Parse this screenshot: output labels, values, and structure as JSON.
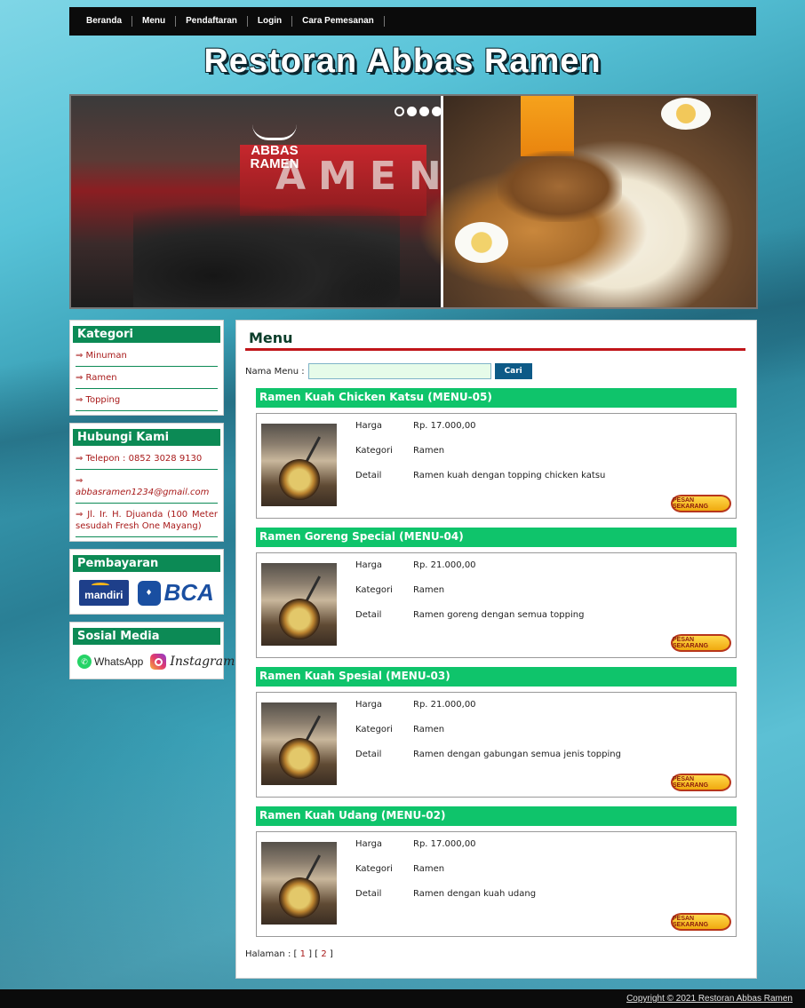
{
  "nav": {
    "items": [
      "Beranda",
      "Menu",
      "Pendaftaran",
      "Login",
      "Cara Pemesanan"
    ]
  },
  "site": {
    "title": "Restoran Abbas Ramen"
  },
  "banner": {
    "logo_line1": "ABBAS",
    "logo_line2": "RAMEN",
    "sign_text": "AMEN",
    "slide_count": 4,
    "active_slide": 1
  },
  "sidebar": {
    "kategori": {
      "title": "Kategori",
      "items": [
        "⇒ Minuman",
        "⇒ Ramen",
        "⇒ Topping"
      ]
    },
    "hubungi": {
      "title": "Hubungi Kami",
      "telepon": "⇒ Telepon : 0852 3028 9130",
      "email": "⇒ abbasramen1234@gmail.com",
      "alamat": "⇒ Jl. Ir. H. Djuanda (100 Meter sesudah Fresh One Mayang)"
    },
    "pembayaran": {
      "title": "Pembayaran",
      "bank1": "mandiri",
      "bank2": "BCA"
    },
    "sosial": {
      "title": "Sosial Media",
      "wa": "WhatsApp",
      "ig": "Instagram"
    }
  },
  "main": {
    "title": "Menu",
    "search_label": "Nama Menu :",
    "search_value": "",
    "search_button": "Cari",
    "labels": {
      "harga": "Harga",
      "kategori": "Kategori",
      "detail": "Detail"
    },
    "order_label": "PESAN SEKARANG",
    "items": [
      {
        "name": "Ramen Kuah Chicken Katsu (MENU-05)",
        "harga": "Rp. 17.000,00",
        "kategori": "Ramen",
        "detail": "Ramen kuah dengan topping chicken katsu"
      },
      {
        "name": "Ramen Goreng Special (MENU-04)",
        "harga": "Rp. 21.000,00",
        "kategori": "Ramen",
        "detail": "Ramen goreng dengan semua topping"
      },
      {
        "name": "Ramen Kuah Spesial (MENU-03)",
        "harga": "Rp. 21.000,00",
        "kategori": "Ramen",
        "detail": "Ramen dengan gabungan semua jenis topping"
      },
      {
        "name": "Ramen Kuah Udang (MENU-02)",
        "harga": "Rp. 17.000,00",
        "kategori": "Ramen",
        "detail": "Ramen dengan kuah udang"
      }
    ],
    "pagination": {
      "label": "Halaman : ",
      "open": "[ ",
      "sep": " ] [ ",
      "close": " ]",
      "pages": [
        "1",
        "2"
      ]
    }
  },
  "footer": {
    "copyright": "Copyright © 2021 Restoran Abbas Ramen"
  },
  "colors": {
    "nav_bg": "#0b0b0b",
    "sidebar_header": "#0c8a55",
    "menu_header": "#0fc46b",
    "accent_red": "#c0151a",
    "link_red": "#a81a1a",
    "button_blue": "#0d5a87"
  }
}
